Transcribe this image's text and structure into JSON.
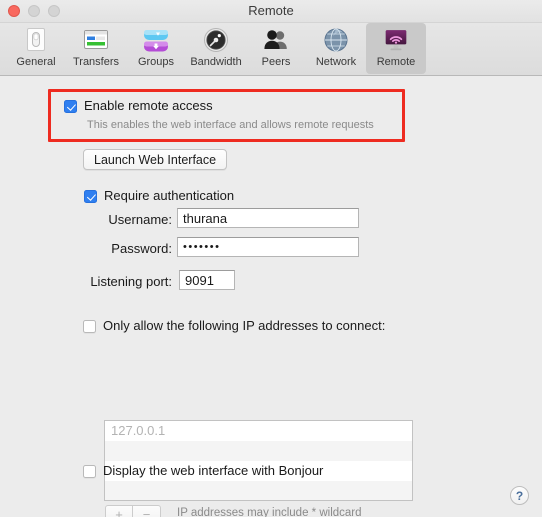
{
  "window": {
    "title": "Remote",
    "controls": {
      "close": "close-button",
      "minimize": "minimize-button",
      "zoom": "zoom-button"
    }
  },
  "toolbar": {
    "items": [
      {
        "label": "General",
        "icon": "general-icon",
        "selected": false
      },
      {
        "label": "Transfers",
        "icon": "transfers-icon",
        "selected": false
      },
      {
        "label": "Groups",
        "icon": "groups-icon",
        "selected": false
      },
      {
        "label": "Bandwidth",
        "icon": "bandwidth-icon",
        "selected": false
      },
      {
        "label": "Peers",
        "icon": "peers-icon",
        "selected": false
      },
      {
        "label": "Network",
        "icon": "network-icon",
        "selected": false
      },
      {
        "label": "Remote",
        "icon": "remote-icon",
        "selected": true
      }
    ]
  },
  "main": {
    "enable_remote": {
      "label": "Enable remote access",
      "checked": true,
      "description": "This enables the web interface and allows remote requests"
    },
    "launch_button": "Launch Web Interface",
    "require_auth": {
      "label": "Require authentication",
      "checked": true
    },
    "username": {
      "label": "Username:",
      "value": "thurana",
      "placeholder": ""
    },
    "password": {
      "label": "Password:",
      "value": "•••••••",
      "placeholder": ""
    },
    "listening_port": {
      "label": "Listening port:",
      "value": "9091"
    },
    "ip_filter": {
      "label": "Only allow the following IP addresses to connect:",
      "checked": false,
      "rows": [
        "127.0.0.1",
        "",
        "",
        ""
      ],
      "add_button": "+",
      "remove_button": "−",
      "hint": "IP addresses may include * wildcard"
    },
    "bonjour": {
      "label": "Display the web interface with Bonjour",
      "checked": false
    },
    "help_button": "?"
  },
  "annotation": {
    "highlight_color": "#ee2b20"
  }
}
